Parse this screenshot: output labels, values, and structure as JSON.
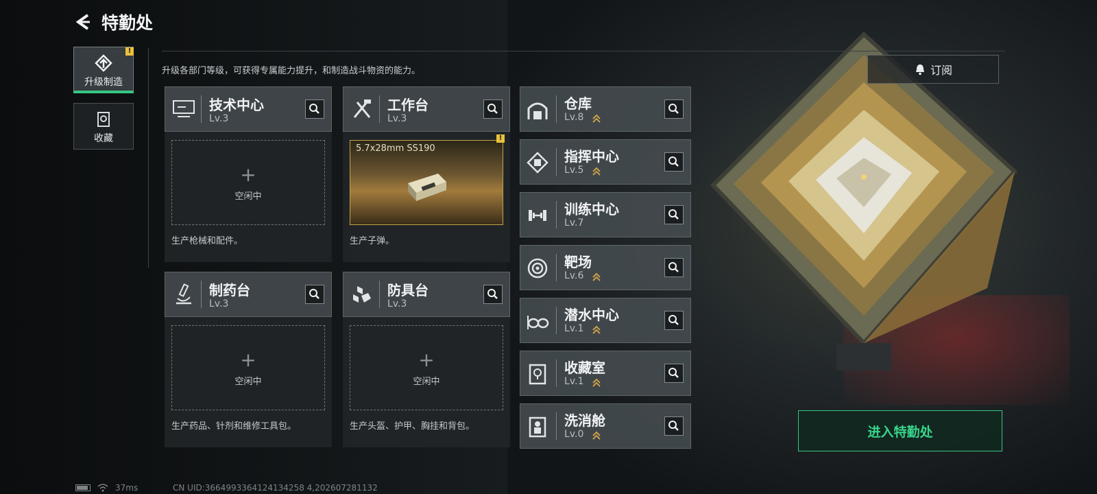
{
  "header": {
    "title": "特勤处",
    "back_icon": "chevron-left-icon"
  },
  "sidebar": {
    "tabs": [
      {
        "label": "升级制造",
        "icon": "upgrade-icon",
        "active": true,
        "alert": "!"
      },
      {
        "label": "收藏",
        "icon": "collection-icon",
        "active": false
      }
    ]
  },
  "description": "升级各部门等级，可获得专属能力提升，和制造战斗物资的能力。",
  "subscribe": {
    "label": "订阅",
    "icon": "bell-icon"
  },
  "workshops": [
    {
      "name": "技术中心",
      "level": "Lv.3",
      "icon": "terminal-icon",
      "slot_plus": "+",
      "slot_status": "空闲中",
      "footer": "生产枪械和配件。"
    },
    {
      "name": "工作台",
      "level": "Lv.3",
      "icon": "tools-icon",
      "slot_item": "5.7x28mm SS190",
      "alert": "!",
      "footer": "生产子弹。"
    },
    {
      "name": "制药台",
      "level": "Lv.3",
      "icon": "microscope-icon",
      "slot_plus": "+",
      "slot_status": "空闲中",
      "footer": "生产药品、针剂和维修工具包。"
    },
    {
      "name": "防具台",
      "level": "Lv.3",
      "icon": "armor-icon",
      "slot_plus": "+",
      "slot_status": "空闲中",
      "footer": "生产头盔、护甲、胸挂和背包。"
    }
  ],
  "facilities": [
    {
      "name": "仓库",
      "level": "Lv.8",
      "icon": "warehouse-icon"
    },
    {
      "name": "指挥中心",
      "level": "Lv.5",
      "icon": "command-icon"
    },
    {
      "name": "训练中心",
      "level": "Lv.7",
      "icon": "dumbbell-icon"
    },
    {
      "name": "靶场",
      "level": "Lv.6",
      "icon": "target-icon"
    },
    {
      "name": "潜水中心",
      "level": "Lv.1",
      "icon": "goggles-icon"
    },
    {
      "name": "收藏室",
      "level": "Lv.1",
      "icon": "trophy-icon"
    },
    {
      "name": "洗消舱",
      "level": "Lv.0",
      "icon": "decon-icon"
    }
  ],
  "enter_button": "进入特勤处",
  "status_bar": {
    "ping": "37ms",
    "uid": "CN UID:3664993364124134258 4,202607281132"
  },
  "colors": {
    "accent": "#34c784",
    "alert": "#e8c23c",
    "upgrade_arrow": "#c9a14a"
  }
}
